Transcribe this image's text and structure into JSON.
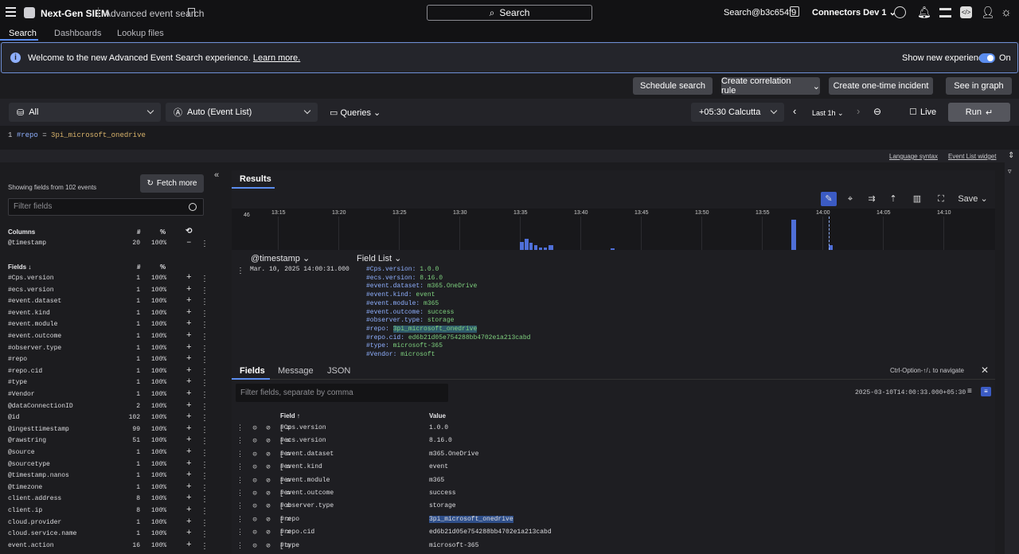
{
  "app": {
    "brand": "Next-Gen SIEM",
    "page": "Advanced event search",
    "search_label": "Search",
    "user": "Search@b3c654f9",
    "tenant": "Connectors Dev 1"
  },
  "tabs": [
    "Search",
    "Dashboards",
    "Lookup files"
  ],
  "banner": {
    "message": "Welcome to the new Advanced Event Search experience.",
    "link": "Learn more.",
    "toggle_label": "Show new experience",
    "toggle_state": "On"
  },
  "actions": [
    "Schedule search",
    "Create correlation rule",
    "Create one-time incident",
    "See in graph"
  ],
  "query_bar": {
    "repo": "All",
    "mode": "Auto (Event List)",
    "queries": "Queries",
    "timezone": "+05:30 Calcutta",
    "range": "Last 1h",
    "live": "Live",
    "run": "Run"
  },
  "editor": {
    "line": "1",
    "field": "#repo",
    "op": "=",
    "value": "3pi_microsoft_onedrive"
  },
  "links": [
    "Language syntax",
    "Event List widget"
  ],
  "left": {
    "showing": "Showing fields from 102 events",
    "fetch": "Fetch more",
    "filter_placeholder": "Filter fields",
    "columns_header": "Columns",
    "hash": "#",
    "pct": "%",
    "columns": [
      {
        "name": "@timestamp",
        "count": "20",
        "pct": "100%"
      }
    ],
    "fields_header": "Fields ↓",
    "fields": [
      {
        "name": "#Cps.version",
        "count": "1",
        "pct": "100%"
      },
      {
        "name": "#ecs.version",
        "count": "1",
        "pct": "100%"
      },
      {
        "name": "#event.dataset",
        "count": "1",
        "pct": "100%"
      },
      {
        "name": "#event.kind",
        "count": "1",
        "pct": "100%"
      },
      {
        "name": "#event.module",
        "count": "1",
        "pct": "100%"
      },
      {
        "name": "#event.outcome",
        "count": "1",
        "pct": "100%"
      },
      {
        "name": "#observer.type",
        "count": "1",
        "pct": "100%"
      },
      {
        "name": "#repo",
        "count": "1",
        "pct": "100%"
      },
      {
        "name": "#repo.cid",
        "count": "1",
        "pct": "100%"
      },
      {
        "name": "#type",
        "count": "1",
        "pct": "100%"
      },
      {
        "name": "#Vendor",
        "count": "1",
        "pct": "100%"
      },
      {
        "name": "@dataConnectionID",
        "count": "2",
        "pct": "100%"
      },
      {
        "name": "@id",
        "count": "102",
        "pct": "100%"
      },
      {
        "name": "@ingesttimestamp",
        "count": "99",
        "pct": "100%"
      },
      {
        "name": "@rawstring",
        "count": "51",
        "pct": "100%"
      },
      {
        "name": "@source",
        "count": "1",
        "pct": "100%"
      },
      {
        "name": "@sourcetype",
        "count": "1",
        "pct": "100%"
      },
      {
        "name": "@timestamp.nanos",
        "count": "1",
        "pct": "100%"
      },
      {
        "name": "@timezone",
        "count": "1",
        "pct": "100%"
      },
      {
        "name": "client.address",
        "count": "8",
        "pct": "100%"
      },
      {
        "name": "client.ip",
        "count": "8",
        "pct": "100%"
      },
      {
        "name": "cloud.provider",
        "count": "1",
        "pct": "100%"
      },
      {
        "name": "cloud.service.name",
        "count": "1",
        "pct": "100%"
      },
      {
        "name": "event.action",
        "count": "16",
        "pct": "100%"
      }
    ]
  },
  "results": {
    "tab": "Results",
    "save": "Save",
    "chart_ticks": [
      "13:15",
      "13:20",
      "13:25",
      "13:30",
      "13:35",
      "13:40",
      "13:45",
      "13:50",
      "13:55",
      "14:00",
      "14:05",
      "14:10"
    ],
    "chart_ymax": "46",
    "col_timestamp": "@timestamp",
    "col_fieldlist": "Field List",
    "event_time": "Mar. 10, 2025 14:00:31.000",
    "event_fields": [
      {
        "k": "#Cps.version:",
        "v": "1.0.0"
      },
      {
        "k": "#ecs.version:",
        "v": "8.16.0"
      },
      {
        "k": "#event.dataset:",
        "v": "m365.OneDrive"
      },
      {
        "k": "#event.kind:",
        "v": "event"
      },
      {
        "k": "#event.module:",
        "v": "m365"
      },
      {
        "k": "#event.outcome:",
        "v": "success"
      },
      {
        "k": "#observer.type:",
        "v": "storage"
      },
      {
        "k": "#repo:",
        "v": "3pi_microsoft_onedrive"
      },
      {
        "k": "#repo.cid:",
        "v": "ed6b21d05e754288bb4702e1a213cabd"
      },
      {
        "k": "#type:",
        "v": "microsoft-365"
      },
      {
        "k": "#Vendor:",
        "v": "microsoft"
      }
    ]
  },
  "detail": {
    "tabs": [
      "Fields",
      "Message",
      "JSON"
    ],
    "nav_hint": "Ctrl-Option-↑/↓ to navigate",
    "filter_placeholder": "Filter fields, separate by comma",
    "timestamp": "2025-03-10T14:00:33.000+05:30",
    "col_field": "Field ↑",
    "col_value": "Value",
    "rows": [
      {
        "k": "#Cps.version",
        "v": "1.0.0"
      },
      {
        "k": "#ecs.version",
        "v": "8.16.0"
      },
      {
        "k": "#event.dataset",
        "v": "m365.OneDrive"
      },
      {
        "k": "#event.kind",
        "v": "event"
      },
      {
        "k": "#event.module",
        "v": "m365"
      },
      {
        "k": "#event.outcome",
        "v": "success"
      },
      {
        "k": "#observer.type",
        "v": "storage"
      },
      {
        "k": "#repo",
        "v": "3pi_microsoft_onedrive"
      },
      {
        "k": "#repo.cid",
        "v": "ed6b21d05e754288bb4702e1a213cabd"
      },
      {
        "k": "#type",
        "v": "microsoft-365"
      }
    ]
  }
}
